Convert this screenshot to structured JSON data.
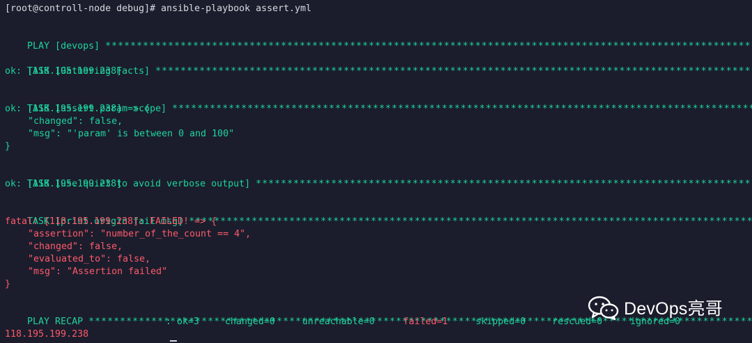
{
  "terminal": {
    "prompt": "[root@controll-node debug]# ansible-playbook assert.yml",
    "play": {
      "label": "PLAY [devops] ",
      "stars": "************************************************************************************************************************************************"
    },
    "task_gathering": {
      "label": "TASK [Gathering Facts] ",
      "stars": "******************************************************************************************************************************************",
      "status": "ok: [118.195.199.238]"
    },
    "task_assert_scope": {
      "label": "TASK [assert param scope] ",
      "stars": "***************************************************************************************************************************************",
      "status": "ok: [118.195.199.238] => {",
      "changed": "\"changed\": false,",
      "msg": "\"msg\": \"'param' is between 0 and 100\"",
      "close": "}"
    },
    "task_quiet": {
      "label": "TASK [use quiet to avoid verbose output] ",
      "stars": "************************************************************************************************************************",
      "status": "ok: [118.195.199.238]"
    },
    "task_print_fail": {
      "label": "TASK [print origin fail msg] ",
      "stars": "*************************************************************************************************************************************",
      "status": "fatal: [118.195.199.238]: FAILED! => {",
      "assertion": "\"assertion\": \"number_of_the_count == 4\",",
      "changed": "\"changed\": false,",
      "evaluated_to": "\"evaluated_to\": false,",
      "msg": "\"msg\": \"Assertion failed\"",
      "close": "}"
    },
    "recap": {
      "label": "PLAY RECAP ",
      "stars": "********************************************************************************************************************************************",
      "host": "118.195.199.238",
      "ok": ": ok=3",
      "changed": "changed=0",
      "unreachable": "unreachable=0",
      "failed": "failed=1",
      "skipped": "skipped=0",
      "rescued": "rescued=0",
      "ignored": "ignored=0"
    }
  },
  "watermark": {
    "text": "DevOps亮哥",
    "icon": "wechat-icon"
  },
  "colors": {
    "background": "#1b1d2c",
    "plain": "#d7dbe2",
    "green": "#1fd39e",
    "red": "#ff5a6b",
    "watermark": "#ffffff"
  }
}
